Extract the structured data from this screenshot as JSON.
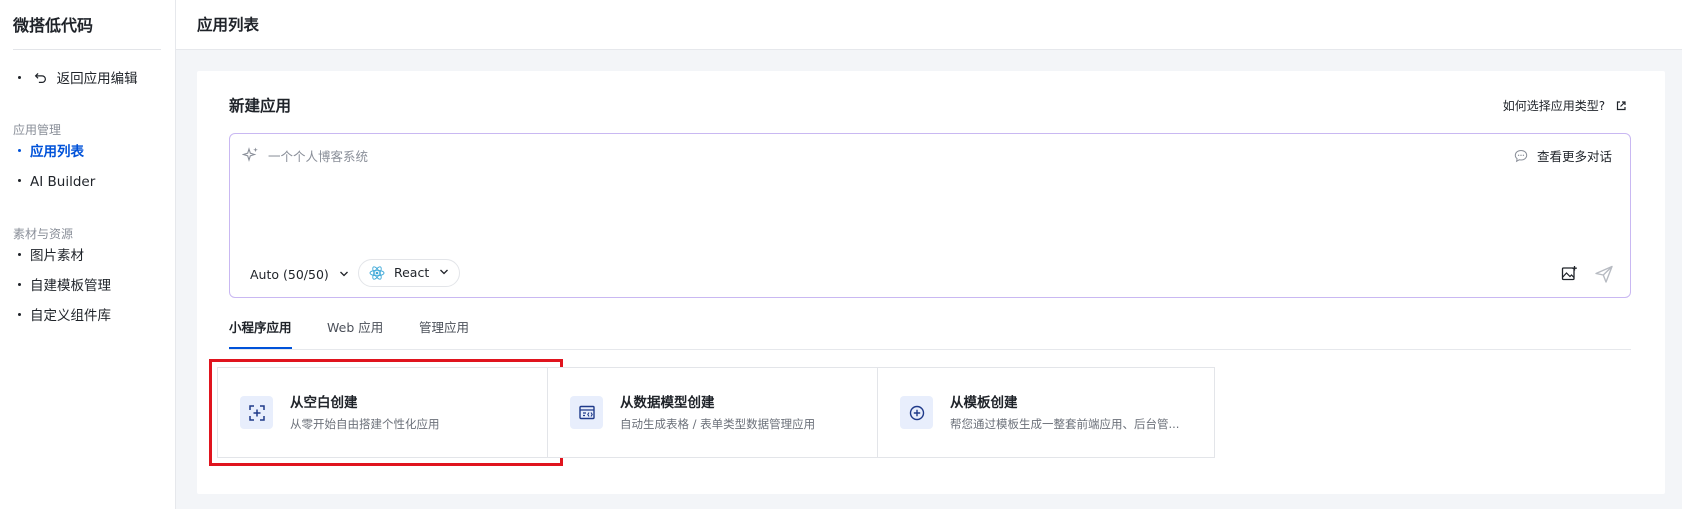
{
  "sidebar": {
    "brand": "微搭低代码",
    "back_label": "返回应用编辑",
    "groups": [
      {
        "label": "应用管理",
        "items": [
          {
            "label": "应用列表",
            "active": true
          },
          {
            "label": "AI Builder"
          }
        ]
      },
      {
        "label": "素材与资源",
        "items": [
          {
            "label": "图片素材"
          },
          {
            "label": "自建模板管理"
          },
          {
            "label": "自定义组件库"
          }
        ]
      }
    ]
  },
  "header": {
    "title": "应用列表"
  },
  "new_app": {
    "title": "新建应用",
    "help_link": "如何选择应用类型?",
    "prompt": {
      "placeholder": "一个个人博客系统",
      "value": "",
      "more_chat": "查看更多对话",
      "model": "Auto (50/50)",
      "framework": "React"
    },
    "tabs": [
      {
        "label": "小程序应用",
        "active": true
      },
      {
        "label": "Web 应用"
      },
      {
        "label": "管理应用"
      }
    ],
    "options": [
      {
        "title": "从空白创建",
        "desc": "从零开始自由搭建个性化应用",
        "icon": "scan-plus-icon",
        "highlighted": true
      },
      {
        "title": "从数据模型创建",
        "desc": "自动生成表格 / 表单类型数据管理应用",
        "icon": "data-model-icon"
      },
      {
        "title": "从模板创建",
        "desc": "帮您通过模板生成一整套前端应用、后台管...",
        "icon": "add-circle-icon"
      }
    ]
  },
  "colors": {
    "accent": "#0052d9",
    "highlight": "#e0141e",
    "prompt_border": "#c9b8f2"
  }
}
